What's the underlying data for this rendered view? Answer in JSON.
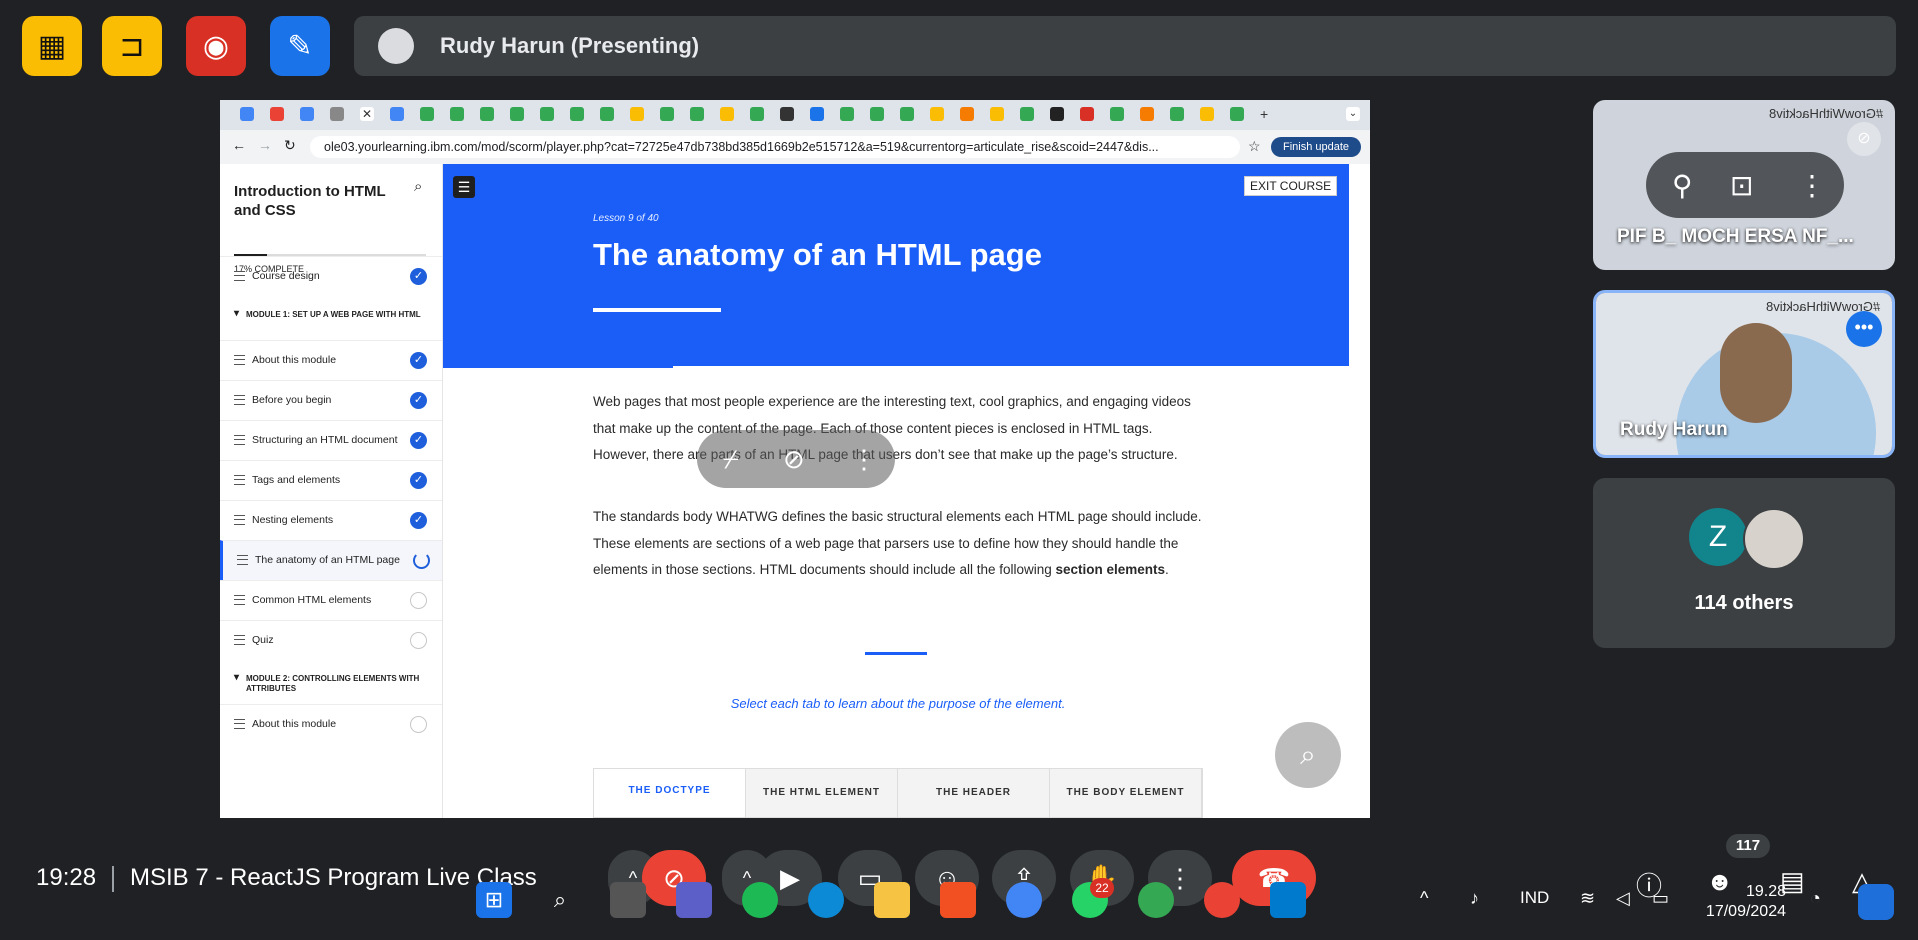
{
  "presenter": {
    "name": "Rudy Harun (Presenting)"
  },
  "browser": {
    "url": "ole03.yourlearning.ibm.com/mod/scorm/player.php?cat=72725e47db738bd385d1669b2e515712&a=519&currentorg=articulate_rise&scoid=2447&dis...",
    "finish_update": "Finish update"
  },
  "course": {
    "title": "Introduction to HTML and CSS",
    "progress_fraction": 0.17,
    "progress_text": "17% COMPLETE",
    "items": [
      {
        "label": "Course design",
        "status": "done"
      },
      {
        "label": "MODULE 1: SET UP A WEB PAGE WITH HTML",
        "type": "module"
      },
      {
        "label": "About this module",
        "status": "done"
      },
      {
        "label": "Before you begin",
        "status": "done"
      },
      {
        "label": "Structuring an HTML document",
        "status": "done"
      },
      {
        "label": "Tags and elements",
        "status": "done"
      },
      {
        "label": "Nesting elements",
        "status": "done"
      },
      {
        "label": "The anatomy of an HTML page",
        "status": "current"
      },
      {
        "label": "Common HTML elements",
        "status": "todo"
      },
      {
        "label": "Quiz",
        "status": "todo"
      },
      {
        "label": "MODULE 2: CONTROLLING ELEMENTS WITH ATTRIBUTES",
        "type": "module"
      },
      {
        "label": "About this module",
        "status": "todo"
      }
    ],
    "exit": "EXIT COURSE",
    "lesson_number": "Lesson 9 of 40",
    "lesson_title": "The anatomy of an HTML page",
    "para1": "Web pages that most people experience are the interesting text, cool graphics, and engaging videos that make up the content of the page. Each of those content pieces is enclosed in HTML tags. However, there are parts of an HTML page that users don’t see that make up the page’s structure.",
    "para2_a": "The standards body WHATWG defines the basic structural elements each HTML page should include. These elements are sections of a web page that parsers use to define how they should handle the elements in those sections. HTML documents should include all the following ",
    "para2_b": "section elements",
    "para2_c": ".",
    "hint": "Select each tab to learn about the purpose of the element.",
    "tabs": [
      "THE DOCTYPE",
      "THE HTML ELEMENT",
      "THE HEADER",
      "THE BODY ELEMENT"
    ]
  },
  "participants": {
    "tile1_name": "PIF B_ MOCH ERSA NF_...",
    "tile2_name": "Rudy Harun",
    "others_initial": "Z",
    "others_label": "114 others",
    "watermark": "#GrowWithHacktiv8"
  },
  "meeting": {
    "time": "19:28",
    "title": "MSIB 7 - ReactJS Program Live Class",
    "people_count": "117"
  },
  "taskbar": {
    "whatsapp_badge": "22",
    "lang": "IND",
    "time": "19.28",
    "date": "17/09/2024"
  },
  "colors": {
    "accent": "#1a5ef7",
    "yellow": "#f9ab00",
    "red": "#d93025",
    "blue": "#1a73e8"
  }
}
